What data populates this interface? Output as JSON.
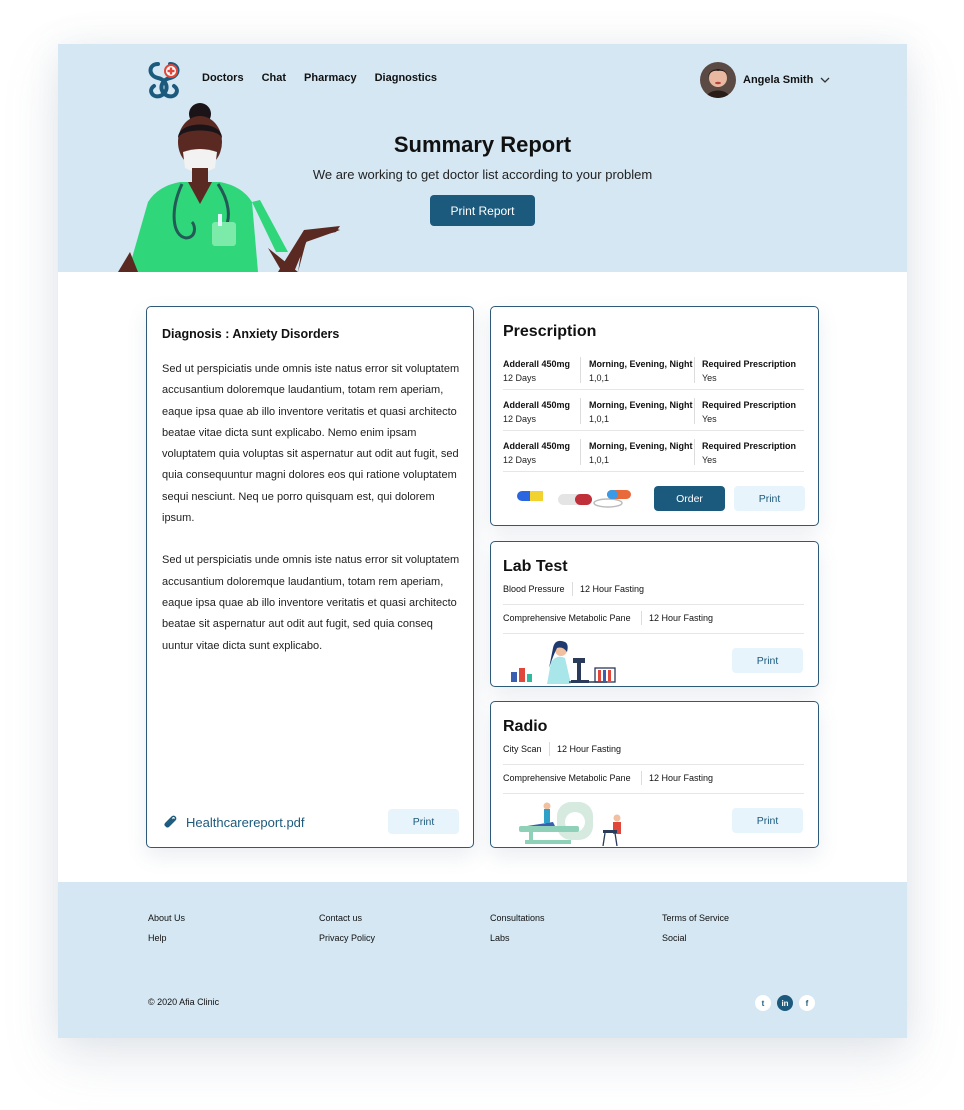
{
  "nav": {
    "items": [
      "Doctors",
      "Chat",
      "Pharmacy",
      "Diagnostics"
    ]
  },
  "user": {
    "name": "Angela Smith"
  },
  "hero": {
    "title": "Summary Report",
    "subtitle": "We are working to get doctor list according to your problem",
    "print_label": "Print Report"
  },
  "diagnosis": {
    "title": "Diagnosis : Anxiety Disorders",
    "paragraphs": [
      "Sed ut perspiciatis unde omnis iste natus error sit voluptatem accusantium doloremque laudantium, totam rem aperiam, eaque ipsa quae ab illo inventore veritatis et quasi architecto beatae vitae dicta sunt explicabo. Nemo enim ipsam voluptatem quia voluptas sit aspernatur aut odit aut fugit, sed quia consequuntur magni dolores eos qui ratione voluptatem sequi nesciunt. Neq ue porro quisquam est, qui dolorem ipsum.",
      "Sed ut perspiciatis unde omnis iste natus error sit voluptatem accusantium doloremque laudantium, totam rem aperiam, eaque ipsa quae ab illo inventore veritatis et quasi architecto beatae sit aspernatur aut odit aut fugit, sed quia conseq uuntur vitae dicta sunt explicabo."
    ],
    "attachment": "Healthcarereport.pdf",
    "print_label": "Print"
  },
  "prescription": {
    "title": "Prescription",
    "rows": [
      {
        "drug": "Adderall 450mg",
        "duration": "12 Days",
        "schedule": "Morning, Evening, Night",
        "dose": "1,0,1",
        "req_label": "Required Prescription",
        "req_value": "Yes"
      },
      {
        "drug": "Adderall 450mg",
        "duration": "12 Days",
        "schedule": "Morning, Evening, Night",
        "dose": "1,0,1",
        "req_label": "Required Prescription",
        "req_value": "Yes"
      },
      {
        "drug": "Adderall 450mg",
        "duration": "12 Days",
        "schedule": "Morning, Evening, Night",
        "dose": "1,0,1",
        "req_label": "Required Prescription",
        "req_value": "Yes"
      }
    ],
    "order_label": "Order",
    "print_label": "Print"
  },
  "lab_test": {
    "title": "Lab Test",
    "rows": [
      {
        "test": "Blood Pressure",
        "note": "12 Hour Fasting"
      },
      {
        "test": "Comprehensive Metabolic Pane",
        "note": "12 Hour Fasting"
      }
    ],
    "print_label": "Print"
  },
  "radio": {
    "title": "Radio",
    "rows": [
      {
        "test": "City Scan",
        "note": "12 Hour Fasting"
      },
      {
        "test": "Comprehensive Metabolic Pane",
        "note": "12 Hour Fasting"
      }
    ],
    "print_label": "Print"
  },
  "footer": {
    "col1": [
      "About Us",
      "Help"
    ],
    "col2": [
      "Contact us",
      "Privacy Policy"
    ],
    "col3": [
      "Consultations",
      "Labs"
    ],
    "col4": [
      "Terms of Service",
      "Social"
    ],
    "copyright": "© 2020 Afia Clinic",
    "social": [
      {
        "icon": "twitter-icon",
        "glyph": "t"
      },
      {
        "icon": "linkedin-icon",
        "glyph": "in"
      },
      {
        "icon": "facebook-icon",
        "glyph": "f"
      }
    ]
  },
  "colors": {
    "accent": "#1c5a7d",
    "hero_bg": "#d4e7f3",
    "light_button": "#e8f4fb"
  }
}
